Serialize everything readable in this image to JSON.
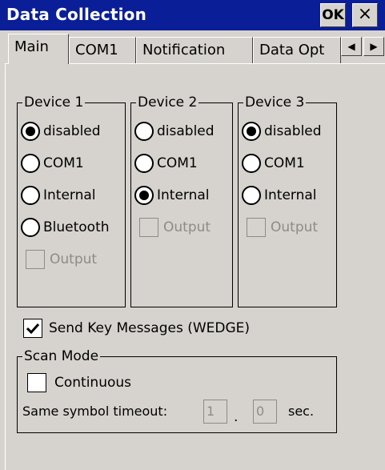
{
  "window": {
    "title": "Data Collection",
    "ok_label": "OK",
    "close_label": "×"
  },
  "tabs": [
    "Main",
    "COM1",
    "Notification",
    "Data Opt"
  ],
  "tab_scroll": {
    "left": "◀",
    "right": "▶"
  },
  "devices": [
    {
      "name": "Device 1",
      "options": [
        "disabled",
        "COM1",
        "Internal",
        "Bluetooth"
      ],
      "selected": "disabled",
      "output_label": "Output",
      "output_checked": false
    },
    {
      "name": "Device 2",
      "options": [
        "disabled",
        "COM1",
        "Internal"
      ],
      "selected": "Internal",
      "output_label": "Output",
      "output_checked": false
    },
    {
      "name": "Device 3",
      "options": [
        "disabled",
        "COM1",
        "Internal"
      ],
      "selected": "disabled",
      "output_label": "Output",
      "output_checked": false
    }
  ],
  "wedge": {
    "label": "Send Key Messages (WEDGE)",
    "checked": true
  },
  "scan_mode": {
    "title": "Scan Mode",
    "continuous_label": "Continuous",
    "continuous_checked": false,
    "timeout_label": "Same symbol timeout:",
    "timeout_value_1": "1",
    "separator": ".",
    "timeout_value_2": "0",
    "unit": "sec."
  }
}
